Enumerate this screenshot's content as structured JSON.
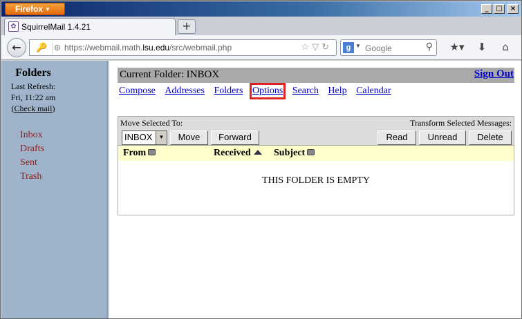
{
  "browser": {
    "menu_label": "Firefox",
    "tab_title": "SquirrelMail 1.4.21",
    "new_tab_symbol": "+",
    "url_prefix": "https://webmail.math.",
    "url_domain": "lsu.edu",
    "url_suffix": "/src/webmail.php",
    "search_placeholder": "Google",
    "window_buttons": [
      "_",
      "□",
      "×"
    ]
  },
  "sidebar": {
    "title": "Folders",
    "last_refresh_label": "Last Refresh:",
    "last_refresh_time": "Fri, 11:22 am",
    "check_mail_open": "(",
    "check_mail_label": "Check mail",
    "check_mail_close": ")",
    "folders": [
      "Inbox",
      "Drafts",
      "Sent",
      "Trash"
    ]
  },
  "main": {
    "current_folder_label": "Current Folder:",
    "current_folder": "INBOX",
    "sign_out": "Sign Out",
    "menu": [
      "Compose",
      "Addresses",
      "Folders",
      "Options",
      "Search",
      "Help",
      "Calendar"
    ],
    "highlighted_menu": "Options",
    "move_selected_label": "Move Selected To:",
    "move_target": "INBOX",
    "move_button": "Move",
    "forward_button": "Forward",
    "transform_label": "Transform Selected Messages:",
    "read_button": "Read",
    "unread_button": "Unread",
    "delete_button": "Delete",
    "columns": {
      "from": "From",
      "received": "Received",
      "subject": "Subject"
    },
    "empty_message": "THIS FOLDER IS EMPTY"
  },
  "colors": {
    "sidebar_bg": "#9fb4ca",
    "folder_link": "#8b2020",
    "link": "#0000cc",
    "highlight_box": "#dd2222",
    "header_bar": "#a9a9a9",
    "column_header_bg": "#ffffcc"
  }
}
